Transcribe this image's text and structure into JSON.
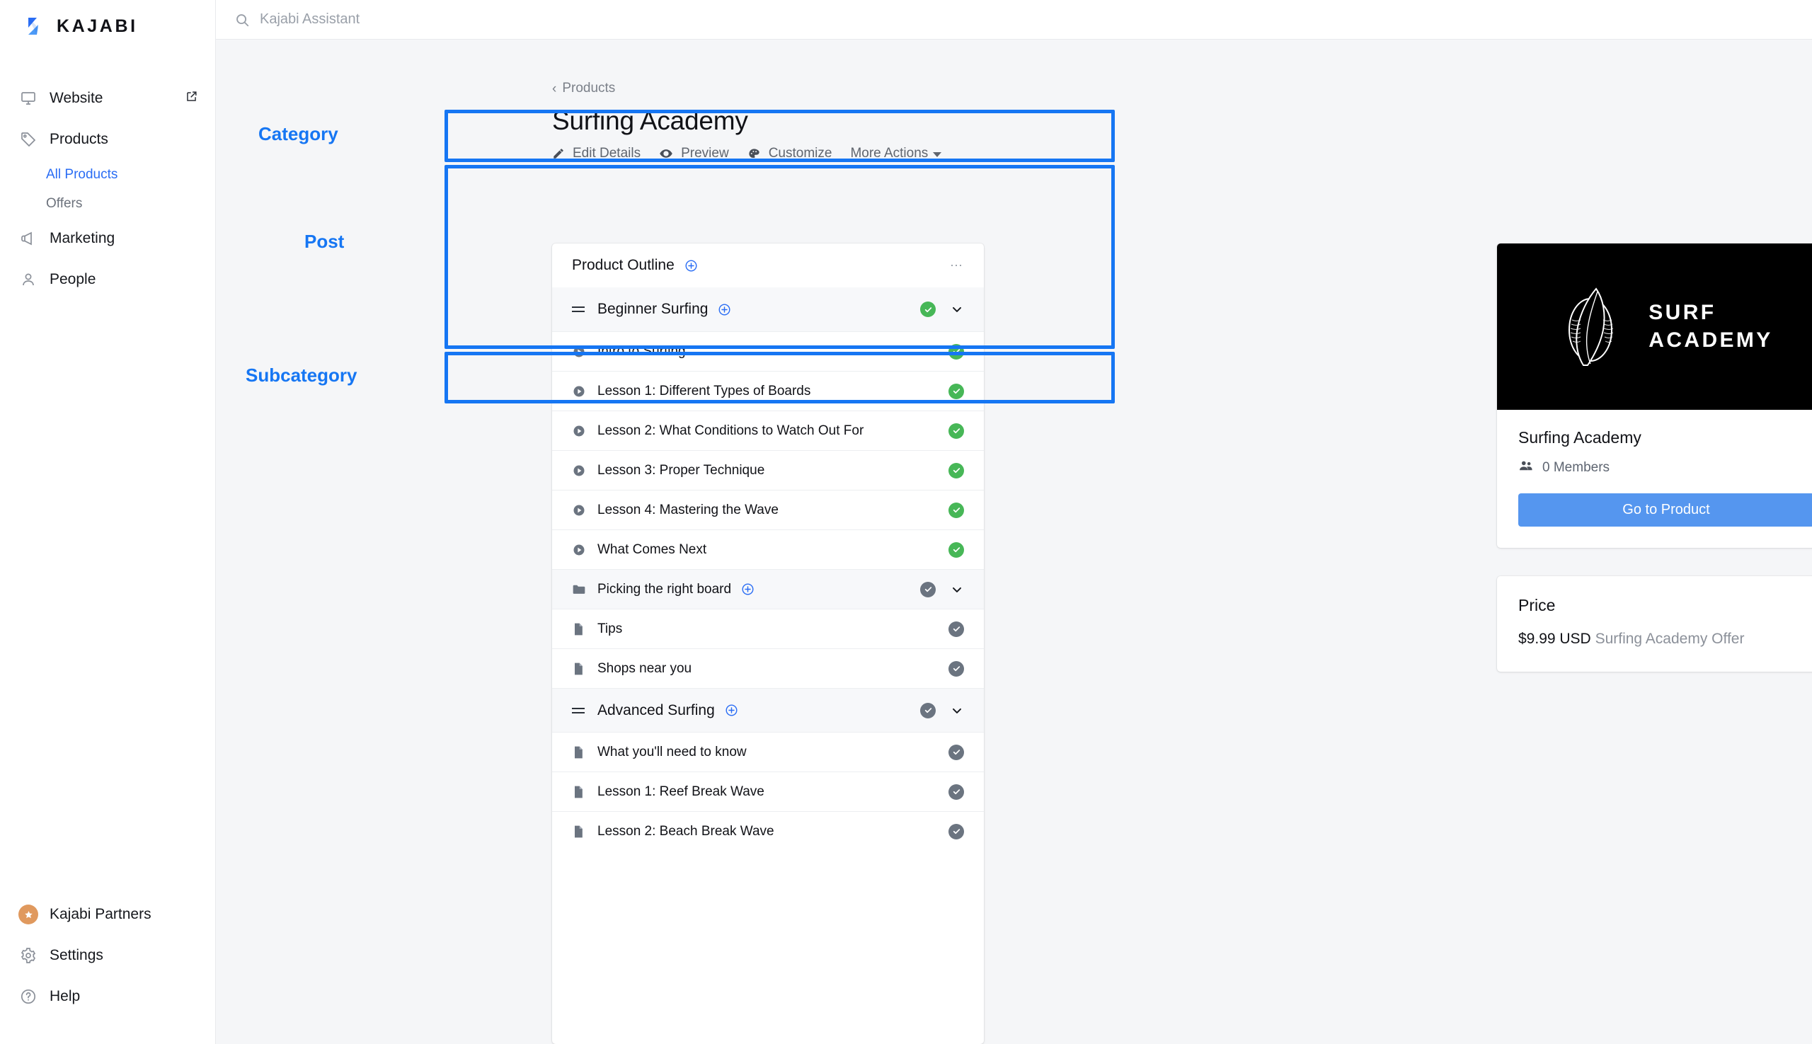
{
  "brand": {
    "name": "KAJABI"
  },
  "topbar": {
    "assistant_placeholder": "Kajabi Assistant",
    "search_icon": "search-icon"
  },
  "sidebar": {
    "items": [
      {
        "label": "Website",
        "icon": "monitor-icon",
        "external": true
      },
      {
        "label": "Products",
        "icon": "tag-icon",
        "external": false
      },
      {
        "label": "Marketing",
        "icon": "megaphone-icon",
        "external": false
      },
      {
        "label": "People",
        "icon": "person-icon",
        "external": false
      }
    ],
    "product_subitems": [
      {
        "label": "All Products",
        "active": true
      },
      {
        "label": "Offers",
        "active": false
      }
    ],
    "bottom_items": [
      {
        "label": "Kajabi Partners",
        "icon": "star-badge-icon"
      },
      {
        "label": "Settings",
        "icon": "gear-icon"
      },
      {
        "label": "Help",
        "icon": "question-circle-icon"
      }
    ]
  },
  "page": {
    "breadcrumb": "Products",
    "title": "Surfing Academy",
    "actions": [
      {
        "label": "Edit Details",
        "icon": "pencil-icon"
      },
      {
        "label": "Preview",
        "icon": "eye-icon"
      },
      {
        "label": "Customize",
        "icon": "palette-icon"
      },
      {
        "label": "More Actions",
        "icon": "caret-down-icon"
      }
    ]
  },
  "outline": {
    "title": "Product Outline",
    "add_icon": "plus-circle-icon",
    "menu_icon": "ellipsis-icon",
    "rows": [
      {
        "label": "Beginner Surfing",
        "type": "category",
        "icon": "drag-handle-icon",
        "status": "green",
        "has_plus": true,
        "has_chevron": true
      },
      {
        "label": "Intro to Surfing",
        "type": "post",
        "icon": "video-play-icon",
        "status": "green",
        "has_plus": false,
        "has_chevron": false
      },
      {
        "label": "Lesson 1: Different Types of Boards",
        "type": "post",
        "icon": "video-play-icon",
        "status": "green",
        "has_plus": false,
        "has_chevron": false
      },
      {
        "label": "Lesson 2: What Conditions to Watch Out For",
        "type": "post",
        "icon": "video-play-icon",
        "status": "green",
        "has_plus": false,
        "has_chevron": false
      },
      {
        "label": "Lesson 3: Proper Technique",
        "type": "post",
        "icon": "video-play-icon",
        "status": "green",
        "has_plus": false,
        "has_chevron": false
      },
      {
        "label": "Lesson 4: Mastering the Wave",
        "type": "post",
        "icon": "video-play-icon",
        "status": "green",
        "has_plus": false,
        "has_chevron": false
      },
      {
        "label": "What Comes Next",
        "type": "post",
        "icon": "video-play-icon",
        "status": "green",
        "has_plus": false,
        "has_chevron": false
      },
      {
        "label": "Picking the right board",
        "type": "subcategory",
        "icon": "folder-icon",
        "status": "gray",
        "has_plus": true,
        "has_chevron": true
      },
      {
        "label": "Tips",
        "type": "post",
        "icon": "document-icon",
        "status": "gray",
        "has_plus": false,
        "has_chevron": false
      },
      {
        "label": "Shops near you",
        "type": "post",
        "icon": "document-icon",
        "status": "gray",
        "has_plus": false,
        "has_chevron": false
      },
      {
        "label": "Advanced Surfing",
        "type": "category",
        "icon": "drag-handle-icon",
        "status": "gray",
        "has_plus": true,
        "has_chevron": true
      },
      {
        "label": "What you'll need to know",
        "type": "post",
        "icon": "document-icon",
        "status": "gray",
        "has_plus": false,
        "has_chevron": false
      },
      {
        "label": "Lesson 1: Reef Break Wave",
        "type": "post",
        "icon": "document-icon",
        "status": "gray",
        "has_plus": false,
        "has_chevron": false
      },
      {
        "label": "Lesson 2: Beach Break Wave",
        "type": "post",
        "icon": "document-icon",
        "status": "gray",
        "has_plus": false,
        "has_chevron": false
      }
    ]
  },
  "annotations": {
    "accent_color": "#1676f3",
    "labels": [
      {
        "text": "Category",
        "target": "Beginner Surfing"
      },
      {
        "text": "Post",
        "target": "post-group"
      },
      {
        "text": "Subcategory",
        "target": "Picking the right board"
      }
    ]
  },
  "product_card": {
    "hero_logo_text_line1": "SURF",
    "hero_logo_text_line2": "ACADEMY",
    "hero_icon": "surfboards-icon",
    "name": "Surfing Academy",
    "members": "0 Members",
    "members_icon": "people-icon",
    "cta_label": "Go to Product"
  },
  "price_card": {
    "title": "Price",
    "amount": "$9.99 USD",
    "offer": "Surfing Academy Offer"
  },
  "colors": {
    "accent_blue": "#2a6df4",
    "highlight_blue": "#1676f3",
    "status_green": "#47b757",
    "status_gray": "#6b7480",
    "cta_blue": "#5596ef"
  }
}
